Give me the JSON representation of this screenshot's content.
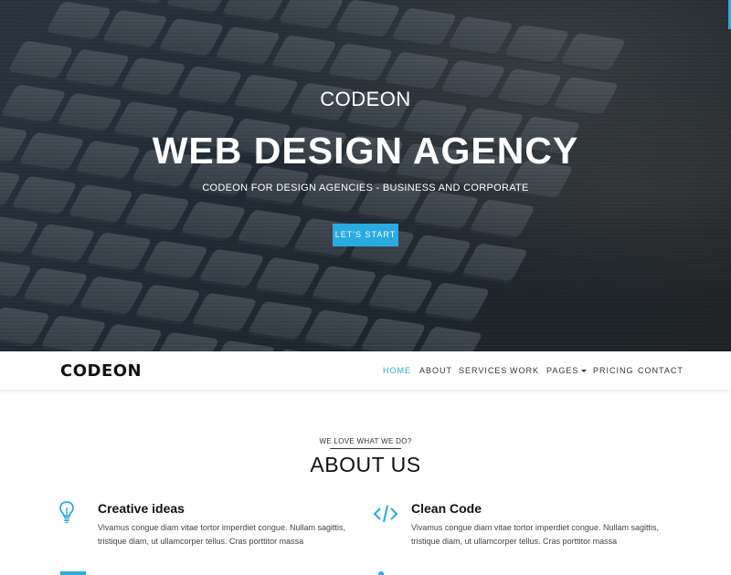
{
  "hero": {
    "subtitle": "CODEON",
    "title": "WEB DESIGN AGENCY",
    "tagline": "CODEON FOR DESIGN AGENCIES - BUSINESS AND CORPORATE",
    "cta_label": "LET'S START"
  },
  "navbar": {
    "logo": "CODEON",
    "items": [
      {
        "label": "HOME",
        "active": true
      },
      {
        "label": "ABOUT"
      },
      {
        "label": "SERVICES"
      },
      {
        "label": "WORK"
      },
      {
        "label": "PAGES",
        "has_dropdown": true
      },
      {
        "label": "PRICING"
      },
      {
        "label": "CONTACT"
      }
    ]
  },
  "about": {
    "kicker": "WE LOVE WHAT WE DO?",
    "title": "ABOUT US",
    "features": [
      {
        "icon": "lightbulb-icon",
        "title": "Creative ideas",
        "text": "Vivamus congue diam vitae tortor imperdiet congue. Nullam sagittis, tristique diam, ut ullamcorper tellus. Cras porttitor massa"
      },
      {
        "icon": "code-icon",
        "title": "Clean Code",
        "text": "Vivamus congue diam vitae tortor imperdiet congue. Nullam sagittis, tristique diam, ut ullamcorper tellus. Cras porttitor massa"
      }
    ]
  },
  "colors": {
    "accent": "#29abe2",
    "hero_overlay": "#1e2833"
  }
}
